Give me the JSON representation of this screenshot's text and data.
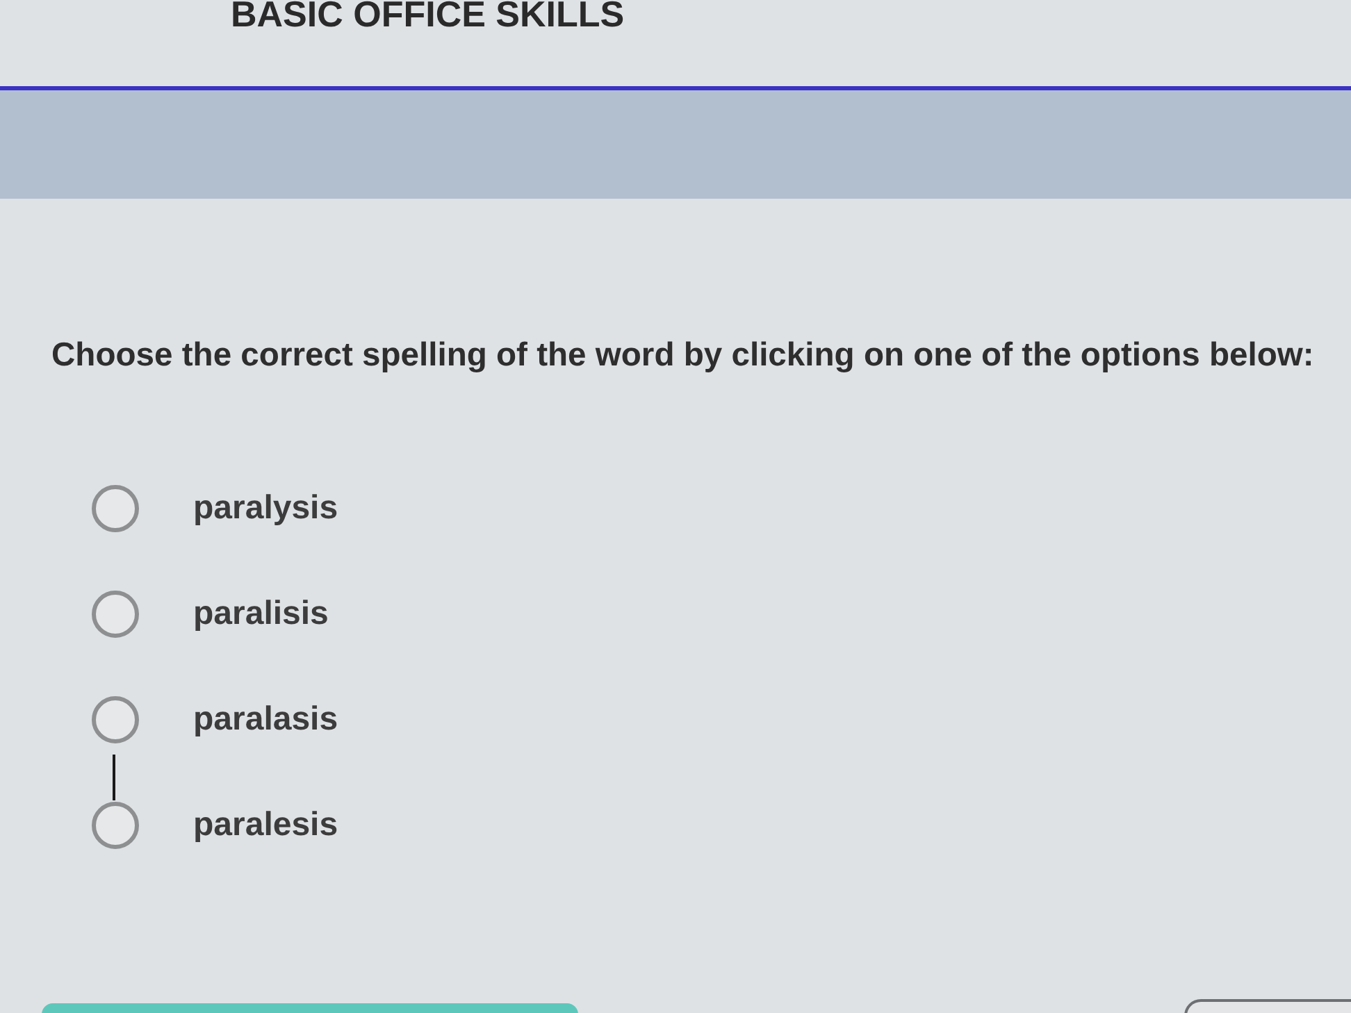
{
  "header": {
    "title": "BASIC OFFICE SKILLS"
  },
  "question": {
    "prompt": "Choose the correct spelling of the word by clicking on one of the options below:"
  },
  "options": [
    {
      "label": "paralysis",
      "selected": false,
      "hovered": false
    },
    {
      "label": "paralisis",
      "selected": false,
      "hovered": false
    },
    {
      "label": "paralasis",
      "selected": false,
      "hovered": false
    },
    {
      "label": "paralesis",
      "selected": false,
      "hovered": true
    }
  ],
  "footer": {
    "buttons": [
      {
        "kind": "primary"
      },
      {
        "kind": "secondary"
      }
    ]
  }
}
